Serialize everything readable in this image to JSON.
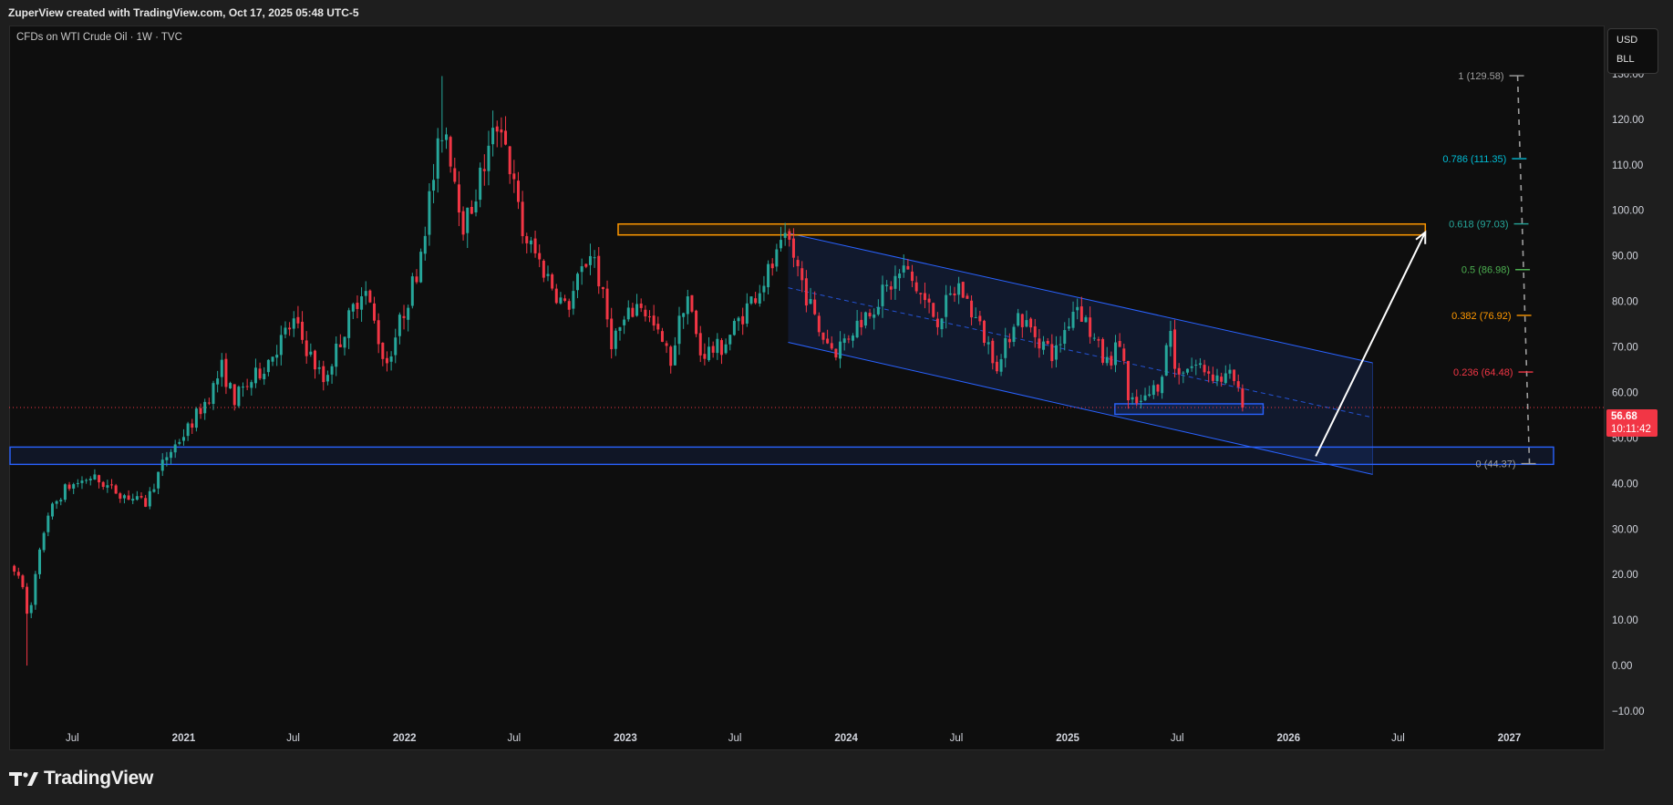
{
  "header": {
    "text": "ZuperView created with TradingView.com, Oct 17, 2025 05:48 UTC-5"
  },
  "symbol": {
    "title": "CFDs on WTI Crude Oil · 1W · TVC"
  },
  "units": {
    "currency": "USD",
    "unit": "BLL"
  },
  "last_price": {
    "price": "56.68",
    "countdown": "10:11:42"
  },
  "brand": {
    "name": "TradingView"
  },
  "colors": {
    "up": "#26a69a",
    "down": "#f23645",
    "background": "#0e0e0e",
    "channel": "#2962ff",
    "resistance": "#ff9800",
    "fib_gray": "#9e9e9e",
    "fib_0786": "#00bcd4",
    "fib_0618": "#26a69a",
    "fib_05": "#4caf50",
    "fib_0382": "#ff9800",
    "fib_0236": "#f23645"
  },
  "chart_data": {
    "type": "candlestick",
    "y_axis": {
      "range": [
        -13,
        141
      ],
      "ticks": [
        -10,
        0,
        10,
        20,
        30,
        40,
        50,
        60,
        70,
        80,
        90,
        100,
        110,
        120,
        130
      ],
      "tick_labels": [
        "−10.00",
        "0.00",
        "10.00",
        "20.00",
        "30.00",
        "40.00",
        "50.00",
        "60.00",
        "70.00",
        "80.00",
        "90.00",
        "100.00",
        "110.00",
        "120.00",
        "130.00"
      ]
    },
    "x_axis": {
      "range": [
        "2020-03-20",
        "2027-03-15"
      ],
      "ticks": [
        {
          "date": "2020-07-01",
          "label": "Jul"
        },
        {
          "date": "2021-01-01",
          "label": "2021"
        },
        {
          "date": "2021-07-01",
          "label": "Jul"
        },
        {
          "date": "2022-01-01",
          "label": "2022"
        },
        {
          "date": "2022-07-01",
          "label": "Jul"
        },
        {
          "date": "2023-01-01",
          "label": "2023"
        },
        {
          "date": "2023-07-01",
          "label": "Jul"
        },
        {
          "date": "2024-01-01",
          "label": "2024"
        },
        {
          "date": "2024-07-01",
          "label": "Jul"
        },
        {
          "date": "2025-01-01",
          "label": "2025"
        },
        {
          "date": "2025-07-01",
          "label": "Jul"
        },
        {
          "date": "2026-01-01",
          "label": "2026"
        },
        {
          "date": "2026-07-01",
          "label": "Jul"
        },
        {
          "date": "2027-01-01",
          "label": "2027"
        }
      ]
    },
    "price_path": [
      [
        "2020-03-27",
        21.5
      ],
      [
        "2020-04-20",
        12
      ],
      [
        "2020-05-20",
        33
      ],
      [
        "2020-06-20",
        39
      ],
      [
        "2020-08-01",
        41.5
      ],
      [
        "2020-09-15",
        38
      ],
      [
        "2020-10-30",
        35.5
      ],
      [
        "2020-12-01",
        45.5
      ],
      [
        "2021-01-08",
        52
      ],
      [
        "2021-02-15",
        60
      ],
      [
        "2021-03-05",
        65.5
      ],
      [
        "2021-03-25",
        58.5
      ],
      [
        "2021-05-10",
        65
      ],
      [
        "2021-07-01",
        75.5
      ],
      [
        "2021-08-20",
        62.5
      ],
      [
        "2021-10-25",
        84
      ],
      [
        "2021-12-01",
        66
      ],
      [
        "2022-01-20",
        86
      ],
      [
        "2022-03-07",
        120
      ],
      [
        "2022-04-10",
        96
      ],
      [
        "2022-06-08",
        121
      ],
      [
        "2022-07-15",
        95
      ],
      [
        "2022-08-15",
        88
      ],
      [
        "2022-09-25",
        78
      ],
      [
        "2022-11-07",
        92
      ],
      [
        "2022-12-09",
        71.5
      ],
      [
        "2023-01-25",
        80
      ],
      [
        "2023-03-17",
        67
      ],
      [
        "2023-04-12",
        82.5
      ],
      [
        "2023-05-04",
        68.5
      ],
      [
        "2023-06-10",
        70
      ],
      [
        "2023-08-10",
        83
      ],
      [
        "2023-09-27",
        93.5
      ],
      [
        "2023-11-15",
        74
      ],
      [
        "2023-12-13",
        69
      ],
      [
        "2024-01-25",
        76
      ],
      [
        "2024-04-05",
        87
      ],
      [
        "2024-05-30",
        76
      ],
      [
        "2024-07-05",
        83.5
      ],
      [
        "2024-09-10",
        65.5
      ],
      [
        "2024-10-07",
        77.5
      ],
      [
        "2024-12-10",
        68
      ],
      [
        "2025-01-15",
        80
      ],
      [
        "2025-03-05",
        66
      ],
      [
        "2025-04-01",
        71.5
      ],
      [
        "2025-04-10",
        57.5
      ],
      [
        "2025-05-05",
        57.5
      ],
      [
        "2025-06-02",
        62.5
      ],
      [
        "2025-06-20",
        74
      ],
      [
        "2025-06-27",
        65
      ],
      [
        "2025-08-05",
        66
      ],
      [
        "2025-09-10",
        63
      ],
      [
        "2025-10-01",
        63.5
      ],
      [
        "2025-10-17",
        56.68
      ]
    ],
    "last_price": 56.68,
    "channel": {
      "upper": [
        [
          "2023-09-27",
          95
        ],
        [
          "2026-05-20",
          66.5
        ]
      ],
      "lower": [
        [
          "2023-09-27",
          71
        ],
        [
          "2026-05-20",
          42
        ]
      ],
      "mid": [
        [
          "2023-09-27",
          83
        ],
        [
          "2026-05-20",
          54.5
        ]
      ]
    },
    "resistance_zone": {
      "from": "2022-12-20",
      "to": "2026-08-15",
      "low": 94.6,
      "high": 97
    },
    "support_zone": {
      "from": "2020-03-20",
      "to": "2027-03-15",
      "low": 44.2,
      "high": 48
    },
    "small_support_zone": {
      "from": "2025-03-20",
      "to": "2025-11-20",
      "low": 55.2,
      "high": 57.5
    },
    "projection_arrow": {
      "from": [
        "2026-02-15",
        46
      ],
      "to": [
        "2026-08-15",
        95.2
      ]
    },
    "fib_levels": [
      {
        "ratio": 1,
        "price": 129.58,
        "label": "1 (129.58)",
        "color": "#9e9e9e"
      },
      {
        "ratio": 0.786,
        "price": 111.35,
        "label": "0.786 (111.35)",
        "color": "#00bcd4"
      },
      {
        "ratio": 0.618,
        "price": 97.03,
        "label": "0.618 (97.03)",
        "color": "#26a69a"
      },
      {
        "ratio": 0.5,
        "price": 86.98,
        "label": "0.5 (86.98)",
        "color": "#4caf50"
      },
      {
        "ratio": 0.382,
        "price": 76.92,
        "label": "0.382 (76.92)",
        "color": "#ff9800"
      },
      {
        "ratio": 0.236,
        "price": 64.48,
        "label": "0.236 (64.48)",
        "color": "#f23645"
      },
      {
        "ratio": 0,
        "price": 44.37,
        "label": "0 (44.37)",
        "color": "#9e9e9e"
      }
    ],
    "grid": false,
    "legend": "none"
  }
}
